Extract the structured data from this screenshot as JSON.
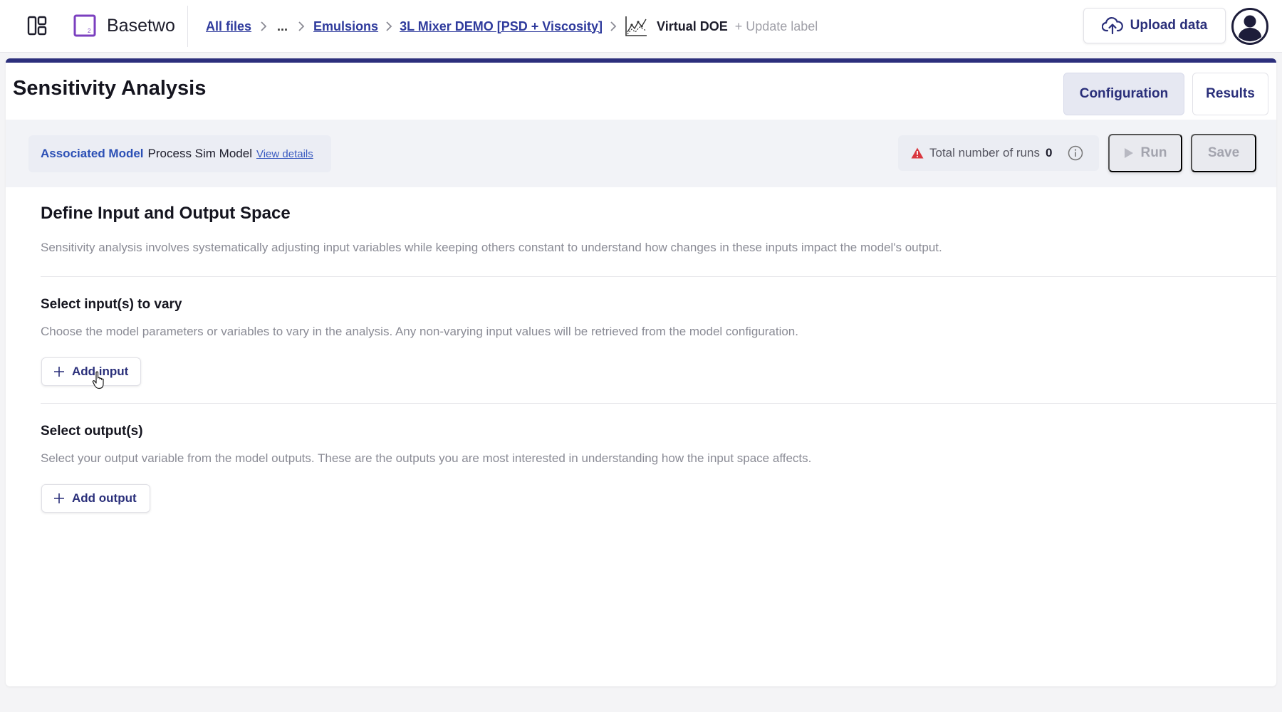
{
  "app": {
    "name": "Basetwo",
    "logo_badge": "2"
  },
  "breadcrumb": {
    "items": [
      "All files",
      "...",
      "Emulsions",
      "3L Mixer DEMO [PSD + Viscosity]"
    ],
    "current": "Virtual DOE",
    "update_label": "+ Update label"
  },
  "header": {
    "upload_label": "Upload data"
  },
  "page": {
    "title": "Sensitivity Analysis",
    "tabs": [
      {
        "label": "Configuration",
        "active": true
      },
      {
        "label": "Results",
        "active": false
      }
    ]
  },
  "model_bar": {
    "associated_label": "Associated Model",
    "model_name": "Process Sim Model",
    "view_details": "View details",
    "runs_label": "Total number of runs",
    "runs_count": "0",
    "run_label": "Run",
    "save_label": "Save"
  },
  "define": {
    "title": "Define Input and Output Space",
    "description": "Sensitivity analysis involves systematically adjusting input variables while keeping others constant to understand how changes in these inputs impact the model's output."
  },
  "inputs": {
    "title": "Select input(s) to vary",
    "description": "Choose the model parameters or variables to vary in the analysis. Any non-varying input values will be retrieved from the model configuration.",
    "add_label": "Add input"
  },
  "outputs": {
    "title": "Select output(s)",
    "description": "Select your output variable from the model outputs. These are the outputs you are most interested in understanding how the input space affects.",
    "add_label": "Add output"
  },
  "colors": {
    "accent": "#2c2f7c",
    "link": "#2b4fb5",
    "brand_purple": "#7b3fbf",
    "warning": "#d9363e"
  },
  "icons": [
    "layout-grid-icon",
    "basetwo-logo-icon",
    "chevron-right-icon",
    "virtual-doe-chart-icon",
    "upload-cloud-icon",
    "user-avatar-icon",
    "warning-triangle-icon",
    "info-circle-icon",
    "play-icon",
    "plus-icon",
    "pointer-cursor-icon"
  ]
}
